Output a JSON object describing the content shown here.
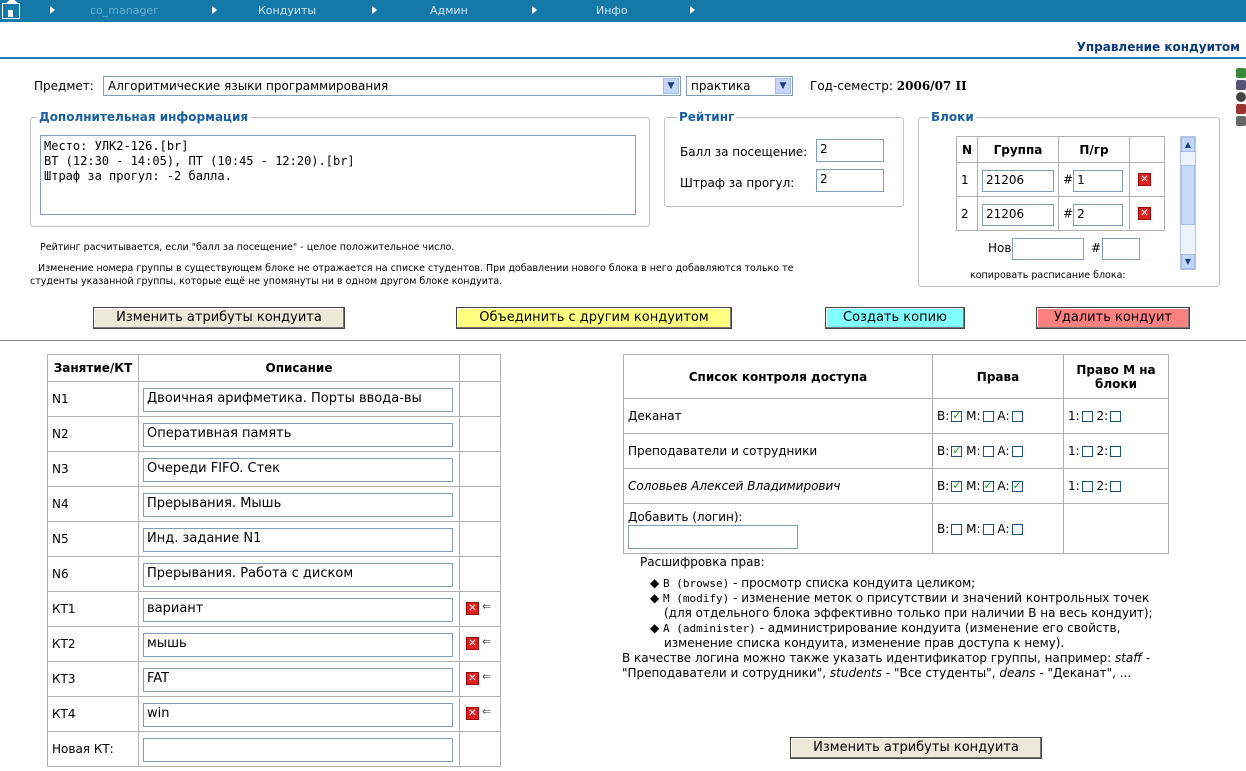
{
  "nav": {
    "items": [
      "co_manager",
      "Кондуиты",
      "Админ",
      "Инфо"
    ]
  },
  "page_title": "Управление кондуитом",
  "subject": {
    "label": "Предмет:",
    "value": "Алгоритмические языки программирования",
    "type_value": "практика",
    "semester_label": "Год-семестр:",
    "semester_value": "2006/07 II"
  },
  "extra_info": {
    "legend": "Дополнительная информация",
    "text": "Место: УЛК2-126.[br]\nВТ (12:30 - 14:05), ПТ (10:45 - 12:20).[br]\nШтраф за прогул: -2 балла."
  },
  "rating": {
    "legend": "Рейтинг",
    "visit_label": "Балл за посещение:",
    "visit_value": "2",
    "penalty_label": "Штраф за прогул:",
    "penalty_value": "2"
  },
  "blocks": {
    "legend": "Блоки",
    "headers": [
      "N",
      "Группа",
      "П/гр"
    ],
    "rows": [
      {
        "n": "1",
        "group": "21206",
        "sub": "1"
      },
      {
        "n": "2",
        "group": "21206",
        "sub": "2"
      }
    ],
    "hash": "#",
    "new_label": "Нов:",
    "copy_text": "копировать расписание блока:"
  },
  "notes": {
    "rating_note": "Рейтинг расчитывается, если \"балл за посещение\" - целое положительное число.",
    "group_note_1": "Изменение номера группы в существующем блоке не отражается на списке студентов. При добавлении нового блока в него добавляются только те",
    "group_note_2": "студенты указанной группы, которые ещё не упомянуты ни в одном другом блоке кондуита."
  },
  "buttons": {
    "change_attrs": "Изменить атрибуты кондуита",
    "merge": "Объединить с другим кондуитом",
    "copy": "Создать копию",
    "delete": "Удалить кондуит",
    "change_attrs_2": "Изменить атрибуты кондуита"
  },
  "lessons": {
    "headers": [
      "Занятие/КТ",
      "Описание"
    ],
    "rows": [
      {
        "id": "N1",
        "desc": "Двоичная арифметика. Порты ввода-вы"
      },
      {
        "id": "N2",
        "desc": "Оперативная память"
      },
      {
        "id": "N3",
        "desc": "Очереди FIFO. Стек"
      },
      {
        "id": "N4",
        "desc": "Прерывания. Мышь"
      },
      {
        "id": "N5",
        "desc": "Инд. задание N1"
      },
      {
        "id": "N6",
        "desc": "Прерывания. Работа с диском"
      },
      {
        "id": "КТ1",
        "desc": "вариант"
      },
      {
        "id": "КТ2",
        "desc": "мышь"
      },
      {
        "id": "КТ3",
        "desc": "FAT"
      },
      {
        "id": "КТ4",
        "desc": "win"
      }
    ],
    "new_label": "Новая КТ:"
  },
  "acl": {
    "headers": [
      "Список контроля доступа",
      "Права",
      "Право М на блоки"
    ],
    "rows": [
      {
        "name": "Деканат",
        "b": true,
        "m": false,
        "a": false
      },
      {
        "name": "Преподаватели и сотрудники",
        "b": true,
        "m": false,
        "a": false
      },
      {
        "name": "Соловьев Алексей Владимирович",
        "b": true,
        "m": true,
        "a": true
      }
    ],
    "add_label": "Добавить (логин):",
    "labels": {
      "b": "В:",
      "m": "М:",
      "a": "А:",
      "one": "1:",
      "two": "2:"
    }
  },
  "legend_rights": {
    "title": "Расшифровка прав:",
    "b_code": "B (browse)",
    "b_text": " - просмотр списка кондуита целиком;",
    "m_code": "M (modify)",
    "m_text": " - изменение меток о присутствии и значений контрольных точек",
    "m_text2": "(для отдельного блока эффективно только при наличии B на весь кондуит);",
    "a_code": "A (administer)",
    "a_text": " - администрирование кондуита (изменение его свойств,",
    "a_text2": "изменение списка кондуита, изменение прав доступа к нему).",
    "login_1a": "В качестве логина можно также указать идентификатор группы, например: ",
    "staff": "staff",
    "login_1b": " -",
    "login_2a": "\"Преподаватели и сотрудники\", ",
    "students": "students",
    "login_2b": " - \"Все студенты\", ",
    "deans": "deans",
    "login_2c": " - \"Деканат\", ..."
  }
}
